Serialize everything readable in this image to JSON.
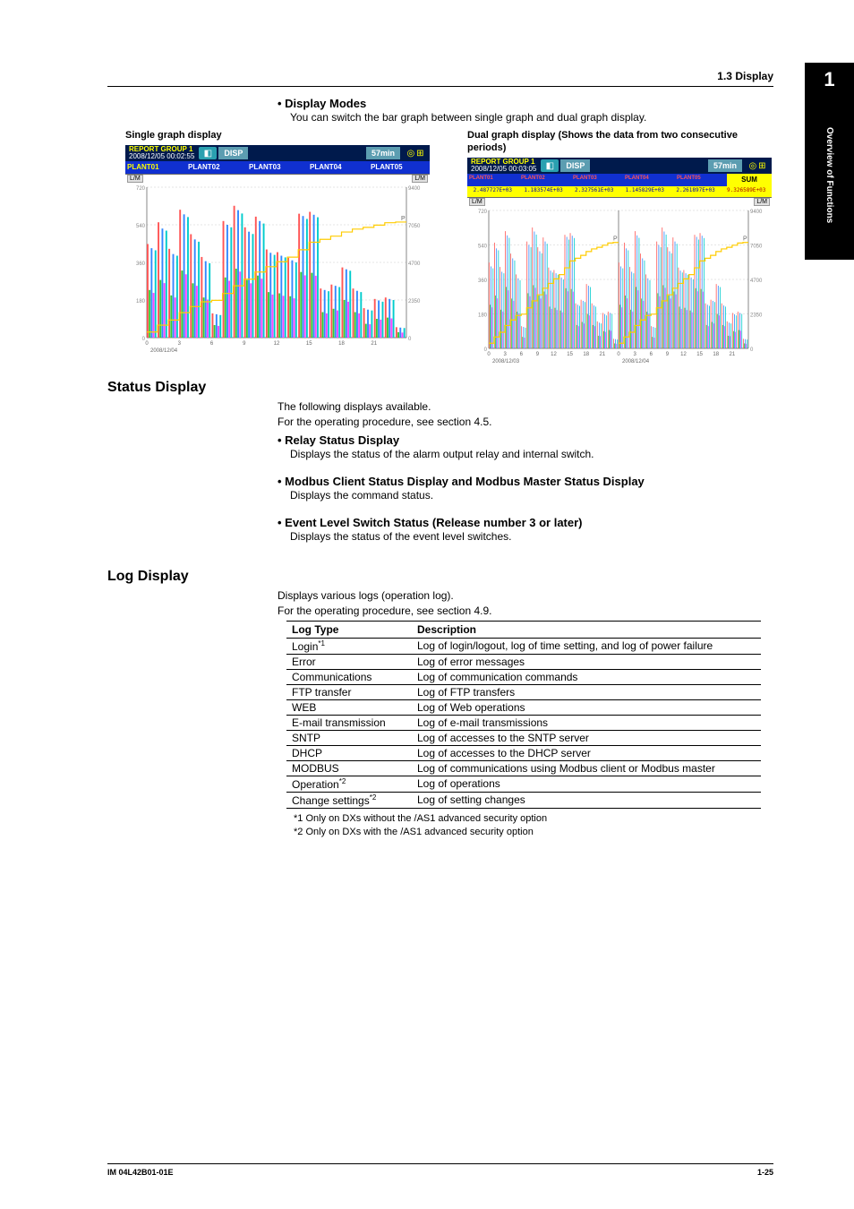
{
  "header": {
    "section": "1.3  Display"
  },
  "chapter": {
    "number": "1",
    "label": "Overview of Functions"
  },
  "display_modes": {
    "title": "Display Modes",
    "desc": "You can switch the bar graph between single graph and dual graph display.",
    "single_caption": "Single graph display",
    "dual_caption": "Dual graph display (Shows the data from two consecutive periods)",
    "screen": {
      "report_line1": "REPORT GROUP 1",
      "single_time": "2008/12/05 00:02:55",
      "dual_time": "2008/12/05 00:03:05",
      "disp": "DISP",
      "timebox": "57min",
      "plants": [
        "PLANT01",
        "PLANT02",
        "PLANT03",
        "PLANT04",
        "PLANT05"
      ],
      "sum": "SUM",
      "LM": "L/M",
      "dual_values": [
        "2.487727E+03",
        "1.183574E+03",
        "2.327561E+03",
        "1.145829E+03",
        "2.261897E+03",
        "9.326589E+03"
      ]
    }
  },
  "status_display": {
    "title": "Status Display",
    "p1": "The following displays available.",
    "p2": "For the operating procedure, see section 4.5.",
    "b1_title": "Relay Status Display",
    "b1_desc": "Displays the status of the alarm output relay and internal switch.",
    "b2_title": "Modbus Client Status Display and Modbus Master Status Display",
    "b2_desc": "Displays the command status.",
    "b3_title": "Event Level Switch Status (Release number 3 or later)",
    "b3_desc": "Displays the status of the event level switches."
  },
  "log_display": {
    "title": "Log Display",
    "p1": "Displays various logs (operation log).",
    "p2": "For the operating procedure, see section 4.9.",
    "col1": "Log Type",
    "col2": "Description",
    "rows": [
      {
        "type": "Login",
        "sup": "*1",
        "desc": "Log of login/logout, log of time setting, and log of power failure"
      },
      {
        "type": "Error",
        "sup": "",
        "desc": "Log of error messages"
      },
      {
        "type": "Communications",
        "sup": "",
        "desc": "Log of communication commands"
      },
      {
        "type": "FTP transfer",
        "sup": "",
        "desc": "Log of FTP transfers"
      },
      {
        "type": "WEB",
        "sup": "",
        "desc": "Log of Web operations"
      },
      {
        "type": "E-mail transmission",
        "sup": "",
        "desc": "Log of e-mail transmissions"
      },
      {
        "type": "SNTP",
        "sup": "",
        "desc": "Log of accesses to the SNTP server"
      },
      {
        "type": "DHCP",
        "sup": "",
        "desc": "Log of accesses to the DHCP server"
      },
      {
        "type": "MODBUS",
        "sup": "",
        "desc": "Log of communications using Modbus client or Modbus master"
      },
      {
        "type": "Operation",
        "sup": "*2",
        "desc": "Log of operations"
      },
      {
        "type": "Change settings",
        "sup": "*2",
        "desc": "Log of setting changes"
      }
    ],
    "note1": "*1  Only on DXs without the /AS1 advanced security option",
    "note2": "*2  Only on DXs with the /AS1 advanced security option"
  },
  "footer": {
    "left": "IM 04L42B01-01E",
    "right": "1-25"
  },
  "chart_data": [
    {
      "type": "bar",
      "title": "Single graph display",
      "xlabel": "hour (2008/12/04)",
      "ylabel": "L/M",
      "x": [
        0,
        1,
        2,
        3,
        4,
        5,
        6,
        7,
        8,
        9,
        10,
        11,
        12,
        13,
        14,
        15,
        16,
        17,
        18,
        19,
        20,
        21,
        22,
        23
      ],
      "x_ticks": [
        0,
        3,
        6,
        9,
        12,
        15,
        18,
        21
      ],
      "ylim_left": [
        0,
        720
      ],
      "left_ticks": [
        0,
        180,
        360,
        540,
        720
      ],
      "ylim_right": [
        0,
        9400
      ],
      "right_ticks": [
        0,
        2350,
        4700,
        7050,
        9400
      ],
      "series": [
        {
          "name": "PLANT01",
          "color": "#ff5555",
          "values": [
            448,
            552,
            425,
            612,
            495,
            386,
            116,
            558,
            631,
            528,
            579,
            422,
            409,
            382,
            593,
            602,
            235,
            254,
            336,
            235,
            141,
            185,
            192,
            50
          ]
        },
        {
          "name": "PLANT02",
          "color": "#33cc33",
          "values": [
            228,
            276,
            202,
            321,
            260,
            192,
            60,
            288,
            330,
            276,
            297,
            218,
            212,
            198,
            314,
            310,
            122,
            138,
            180,
            122,
            66,
            90,
            96,
            26
          ]
        },
        {
          "name": "PLANT03",
          "color": "#3388ff",
          "values": [
            428,
            522,
            400,
            590,
            470,
            366,
            112,
            540,
            610,
            507,
            558,
            406,
            392,
            370,
            582,
            588,
            228,
            248,
            327,
            224,
            134,
            178,
            185,
            48
          ]
        },
        {
          "name": "PLANT04",
          "color": "#ff44ff",
          "values": [
            214,
            261,
            192,
            303,
            248,
            182,
            56,
            272,
            316,
            260,
            282,
            206,
            200,
            188,
            298,
            296,
            116,
            130,
            172,
            116,
            64,
            86,
            92,
            24
          ]
        },
        {
          "name": "PLANT05",
          "color": "#00cccc",
          "values": [
            418,
            512,
            392,
            577,
            459,
            356,
            108,
            528,
            594,
            496,
            546,
            396,
            384,
            360,
            568,
            576,
            222,
            242,
            320,
            218,
            130,
            172,
            180,
            46
          ]
        }
      ],
      "sum_line": {
        "name": "SUM (cumulative)",
        "color": "#ffcc00",
        "max": 9326,
        "approx_values": [
          350,
          780,
          1100,
          1560,
          1940,
          2240,
          2330,
          2760,
          3240,
          3650,
          4100,
          4430,
          4740,
          5030,
          5490,
          5960,
          6140,
          6340,
          6600,
          6780,
          6890,
          7030,
          7180,
          7220
        ]
      }
    },
    {
      "type": "bar",
      "title": "Dual graph display (two consecutive periods)",
      "note": "Left pane = 2008/12/03, Right pane = 2008/12/04, same axes/series as single chart",
      "panes": [
        "2008/12/03",
        "2008/12/04"
      ],
      "sum_totals": [
        9326,
        9326
      ]
    }
  ]
}
